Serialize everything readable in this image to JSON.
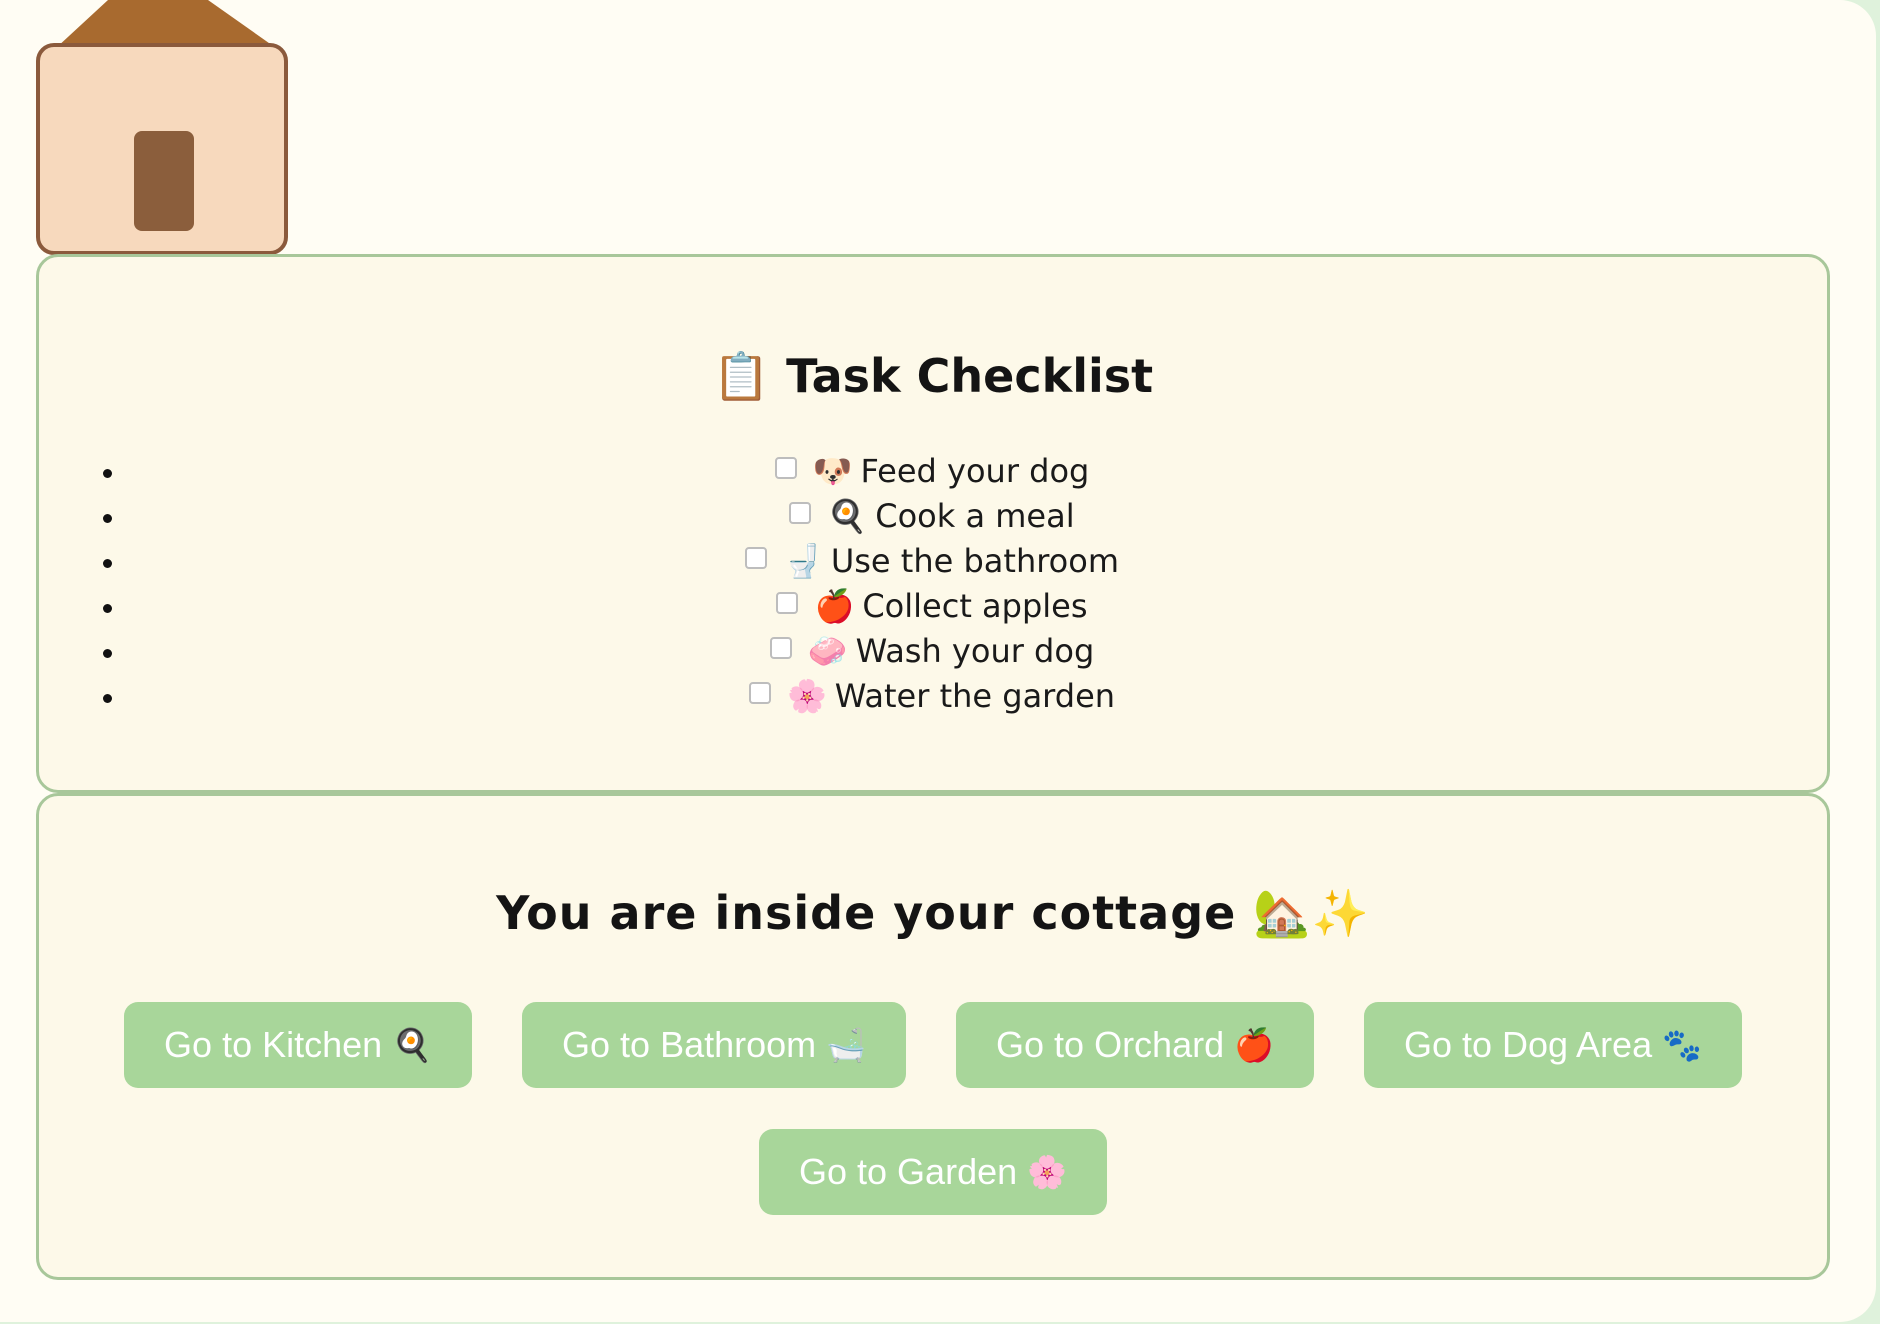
{
  "colors": {
    "page_bg": "#fffdf4",
    "panel_bg": "#fdf9e9",
    "panel_border": "#a8c79a",
    "button_bg": "#a8d69a",
    "button_text": "#ffffff",
    "roof": "#a86a2f",
    "house_wall": "#f7d9bd",
    "door": "#8b5e3c"
  },
  "checklist": {
    "heading_icon": "📋",
    "heading": "Task Checklist",
    "tasks": [
      {
        "icon": "🐶",
        "label": "Feed your dog",
        "checked": false
      },
      {
        "icon": "🍳",
        "label": "Cook a meal",
        "checked": false
      },
      {
        "icon": "🚽",
        "label": "Use the bathroom",
        "checked": false
      },
      {
        "icon": "🍎",
        "label": "Collect apples",
        "checked": false
      },
      {
        "icon": "🧼",
        "label": "Wash your dog",
        "checked": false
      },
      {
        "icon": "🌸",
        "label": "Water the garden",
        "checked": false
      }
    ]
  },
  "location": {
    "message": "You are inside your cottage 🏡✨",
    "buttons": [
      {
        "label": "Go to Kitchen",
        "icon": "🍳"
      },
      {
        "label": "Go to Bathroom",
        "icon": "🛁"
      },
      {
        "label": "Go to Orchard",
        "icon": "🍎"
      },
      {
        "label": "Go to Dog Area",
        "icon": "🐾"
      },
      {
        "label": "Go to Garden",
        "icon": "🌸"
      }
    ]
  }
}
